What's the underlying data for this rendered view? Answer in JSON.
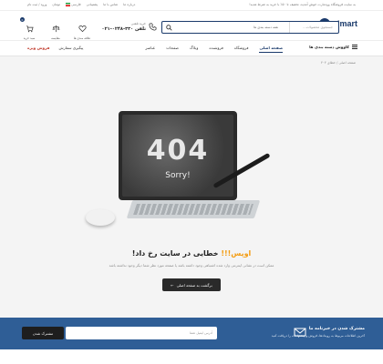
{
  "topbar": {
    "announcement": "به سایت فروشگاه وودمارت خوش آمدید، تخفیف تا ۵۰٪ با خرید به شرط هدیه!",
    "links": [
      "پشتیبانی",
      "تماس با ما",
      "درباره ما"
    ],
    "language": "فارسی",
    "currency": "تومان",
    "account": "ورود / ثبت نام"
  },
  "header": {
    "logo_text": "olmart",
    "logo_mark": "W",
    "search_placeholder": "جستجوی محصولات...",
    "search_category": "همه دسته بندی ها",
    "phone_label": "خرید تلفنی",
    "phone_number": "تلفن ۳۳۰-۰۲۴۸-۰۲۱",
    "icons": [
      {
        "label": "مقایسه",
        "icon": "compare-icon"
      },
      {
        "label": "علاقه مندی ها",
        "icon": "heart-icon"
      },
      {
        "label": "سبد خرید",
        "icon": "cart-icon",
        "badge": "0"
      }
    ]
  },
  "nav": {
    "all_categories": "کاووش دسته بندی ها",
    "menu": [
      "صفحه اصلی",
      "فروشگاه",
      "فروشنده",
      "وبلاگ",
      "صفحات",
      "عناصر"
    ],
    "track_order": "پیگیری سفارش",
    "special_sale": "فروش ویژه"
  },
  "breadcrumb": "صفحه اصلی / خطای ۴۰۴",
  "hero": {
    "screen_code": "404",
    "screen_text": "Sorry!"
  },
  "error": {
    "title_accent": "اوپس!!!",
    "title_rest": " خطایی در سایت رخ داد!",
    "description": "ممکن است در نشانی اینترنتی وارد شده اشتباهی وجود داشته باشد یا صفحه مورد نظر شما دیگر وجود نداشته باشد",
    "button": "برگشت به صفحه اصلی"
  },
  "newsletter": {
    "heading": "مشترک شدن در خبرنامه ما",
    "subtext": "آخرین اطلاعات مربوط به رویدادها، فروش و پیشنهادات را دریافت کنید",
    "placeholder": "آدرس ایمیل شما",
    "button": "مشترک شدن"
  },
  "colors": {
    "brand": "#1a3a6b",
    "accent": "#f39c12",
    "newsletter_bg": "#2f5e96"
  }
}
